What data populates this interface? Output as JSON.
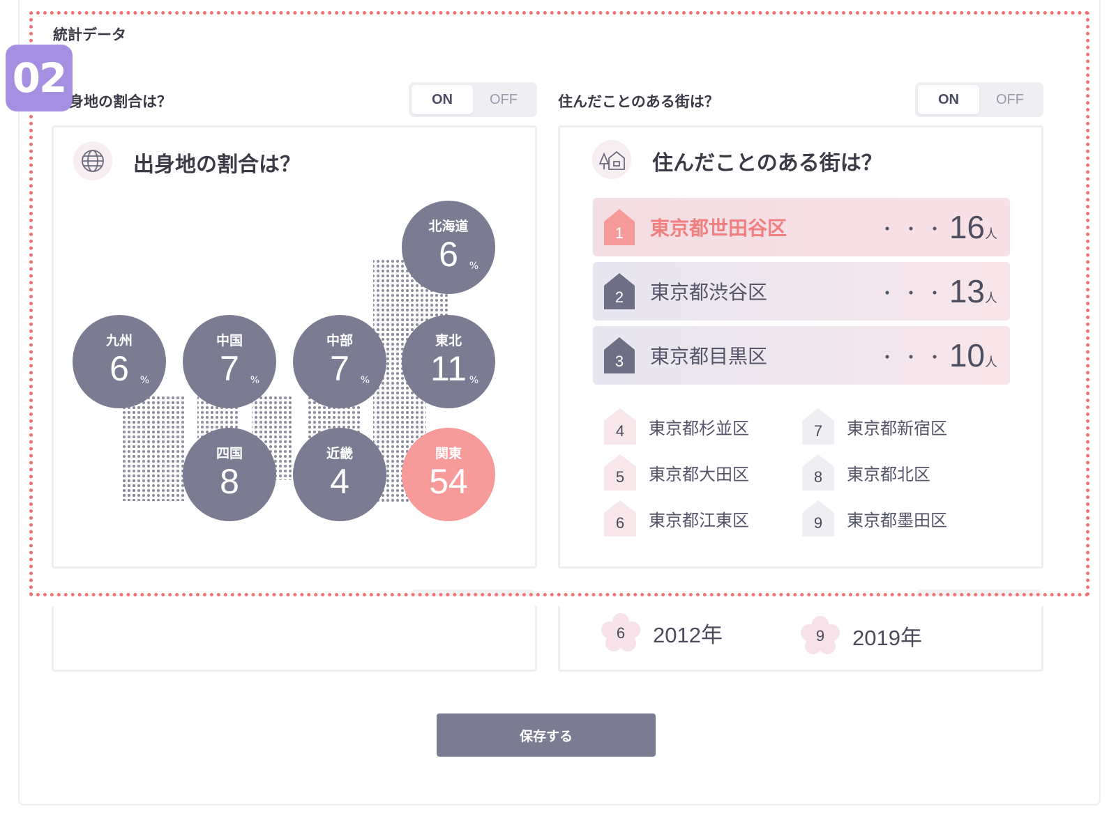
{
  "section_title": "統計データ",
  "step_badge": "02",
  "toggle": {
    "on": "ON",
    "off": "OFF"
  },
  "left": {
    "question": "出身地の割合は？",
    "panel_title": "出身地の割合は？",
    "icon": "globe-icon",
    "regions": [
      {
        "name": "北海道",
        "pct": "6",
        "sign": "%"
      },
      {
        "name": "九州",
        "pct": "6",
        "sign": "%"
      },
      {
        "name": "中国",
        "pct": "7",
        "sign": "%"
      },
      {
        "name": "中部",
        "pct": "7",
        "sign": "%"
      },
      {
        "name": "東北",
        "pct": "11",
        "sign": "%"
      },
      {
        "name": "四国",
        "pct": "8"
      },
      {
        "name": "近畿",
        "pct": "4"
      },
      {
        "name": "関東",
        "pct": "54"
      }
    ],
    "bubble_color": "#7b7b92",
    "highlight_color": "#f69a9a"
  },
  "right": {
    "question": "住んだことのある街は？",
    "panel_title": "住んだことのある街は？",
    "icon": "house-tree-icon",
    "top_ranks": [
      {
        "rank": "1",
        "name": "東京都世田谷区",
        "dots": "・・・",
        "count": "16",
        "unit": "人"
      },
      {
        "rank": "2",
        "name": "東京都渋谷区",
        "dots": "・・・",
        "count": "13",
        "unit": "人"
      },
      {
        "rank": "3",
        "name": "東京都目黒区",
        "dots": "・・・",
        "count": "10",
        "unit": "人"
      }
    ],
    "other_ranks": [
      {
        "rank": "4",
        "name": "東京都杉並区"
      },
      {
        "rank": "5",
        "name": "東京都大田区"
      },
      {
        "rank": "6",
        "name": "東京都江東区"
      },
      {
        "rank": "7",
        "name": "東京都新宿区"
      },
      {
        "rank": "8",
        "name": "東京都北区"
      },
      {
        "rank": "9",
        "name": "東京都墨田区"
      }
    ],
    "accent_color": "#f08080"
  },
  "lower": {
    "years": [
      {
        "rank": "6",
        "year": "2012年"
      },
      {
        "rank": "9",
        "year": "2019年"
      }
    ]
  },
  "save_label": "保存する"
}
